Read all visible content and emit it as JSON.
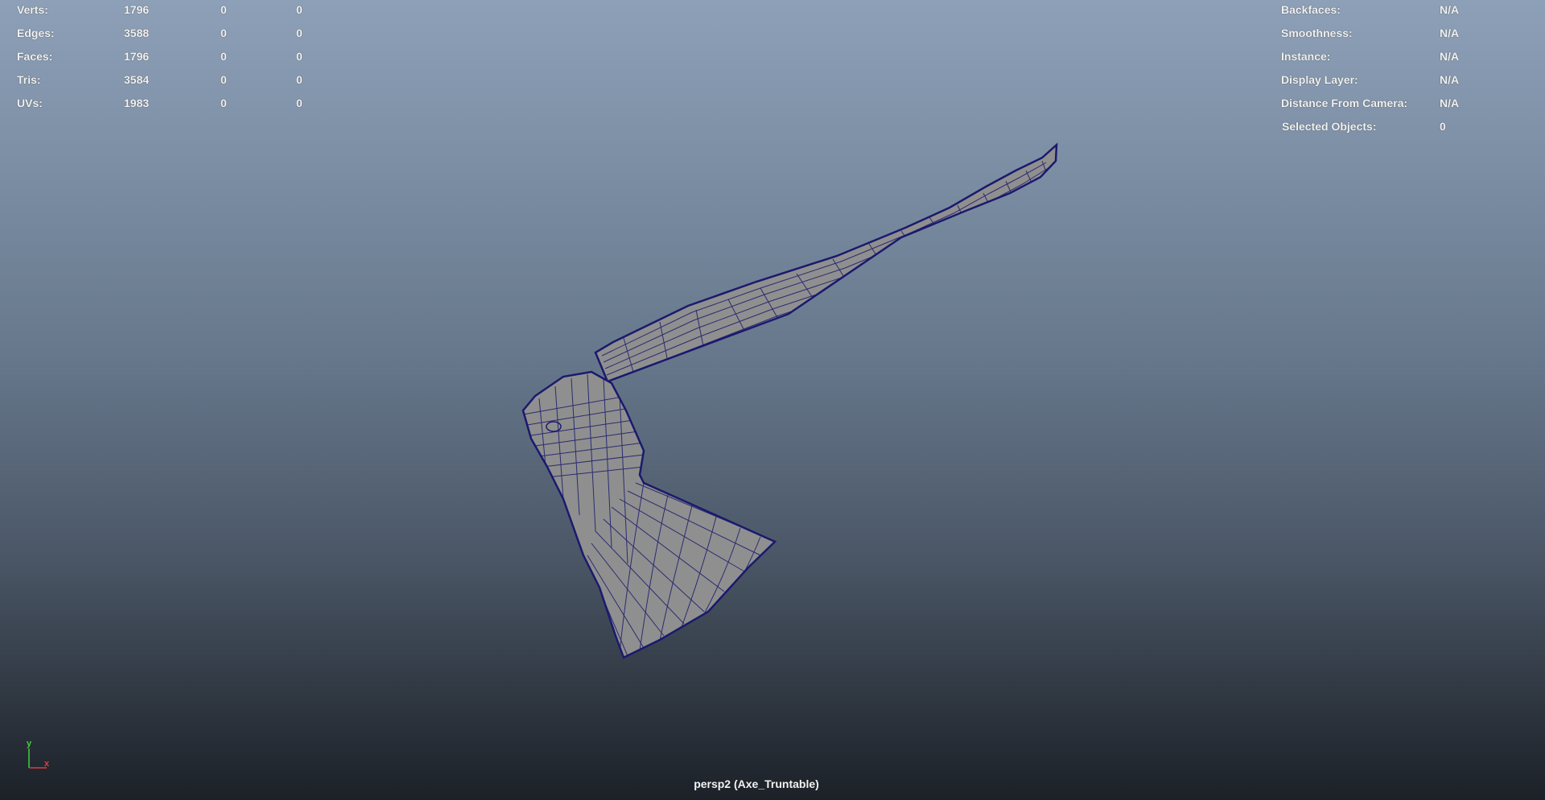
{
  "stats": {
    "rows": [
      {
        "label": "Verts:",
        "v1": "1796",
        "v2": "0",
        "v3": "0"
      },
      {
        "label": "Edges:",
        "v1": "3588",
        "v2": "0",
        "v3": "0"
      },
      {
        "label": "Faces:",
        "v1": "1796",
        "v2": "0",
        "v3": "0"
      },
      {
        "label": "Tris:",
        "v1": "3584",
        "v2": "0",
        "v3": "0"
      },
      {
        "label": "UVs:",
        "v1": "1983",
        "v2": "0",
        "v3": "0"
      }
    ]
  },
  "info": {
    "rows": [
      {
        "label": "Backfaces:",
        "value": "N/A"
      },
      {
        "label": "Smoothness:",
        "value": "N/A"
      },
      {
        "label": "Instance:",
        "value": "N/A"
      },
      {
        "label": "Display Layer:",
        "value": "N/A"
      },
      {
        "label": "Distance From Camera:",
        "value": "N/A"
      },
      {
        "label": "Selected Objects:",
        "value": "0"
      }
    ]
  },
  "gizmo": {
    "y_label": "y",
    "x_label": "x",
    "y_color": "#3fd13f",
    "x_color": "#e03b3b"
  },
  "camera": {
    "label": "persp2 (Axe_Truntable)"
  },
  "colors": {
    "wire": "#1a1a6e",
    "mesh_fill": "#8f8f8f"
  },
  "icons": {
    "mesh": "axe-mesh-icon",
    "gizmo": "axis-gizmo-icon"
  }
}
